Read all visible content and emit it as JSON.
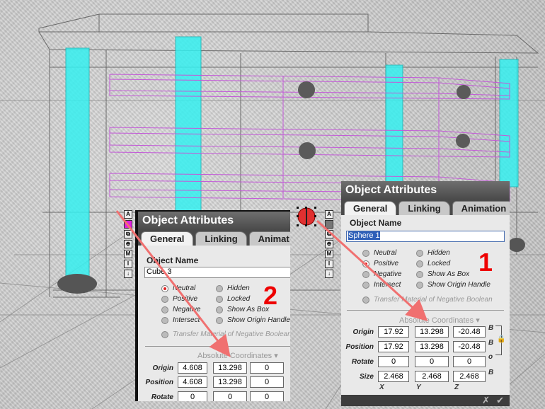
{
  "panel_right": {
    "title": "Object Attributes",
    "tabs": [
      "General",
      "Linking",
      "Animation"
    ],
    "object_name_label": "Object Name",
    "object_name_value": "Sphere 1",
    "options": {
      "neutral": "Neutral",
      "positive": "Positive",
      "negative": "Negative",
      "intersect": "Intersect",
      "hidden": "Hidden",
      "locked": "Locked",
      "show_as_box": "Show As Box",
      "show_origin_handle": "Show Origin Handle"
    },
    "selected_option": "Positive",
    "transfer": "Transfer Material of Negative Boolean",
    "abs_coords": "Absolute Coordinates",
    "rows": {
      "origin": {
        "label": "Origin",
        "x": "17.92",
        "y": "13.298",
        "z": "-20.48"
      },
      "position": {
        "label": "Position",
        "x": "17.92",
        "y": "13.298",
        "z": "-20.48"
      },
      "rotate": {
        "label": "Rotate",
        "x": "0",
        "y": "0",
        "z": "0"
      },
      "size": {
        "label": "Size",
        "x": "2.468",
        "y": "2.468",
        "z": "2.468"
      }
    },
    "axes": {
      "x": "X",
      "y": "Y",
      "z": "Z"
    },
    "side_b": "B",
    "side_deg": "o",
    "callout": "1",
    "footer_cancel": "✗",
    "footer_ok": "✔"
  },
  "panel_left": {
    "title": "Object Attributes",
    "tabs": [
      "General",
      "Linking",
      "Animat"
    ],
    "object_name_label": "Object Name",
    "object_name_value": "Cube 3",
    "options": {
      "neutral": "Neutral",
      "positive": "Positive",
      "negative": "Negative",
      "intersect": "Intersect",
      "hidden": "Hidden",
      "locked": "Locked",
      "show_as_box": "Show As Box",
      "show_origin_handle": "Show Origin Handle"
    },
    "selected_option": "Neutral",
    "transfer": "Transfer Material of Negative Boolean",
    "abs_coords": "Absolute Coordinates",
    "rows": {
      "origin": {
        "label": "Origin",
        "x": "4.608",
        "y": "13.298",
        "z": "0"
      },
      "position": {
        "label": "Position",
        "x": "4.608",
        "y": "13.298",
        "z": "0"
      },
      "rotate": {
        "label": "Rotate",
        "x": "0",
        "y": "0",
        "z": "0"
      }
    },
    "callout": "2"
  },
  "toolstrip": {
    "labels": [
      "A",
      "■",
      "⧉",
      "⊕",
      "M",
      "I",
      "↓"
    ]
  },
  "colors": {
    "cyan": "#36f0f0",
    "magenta": "#c35ad8",
    "arrow": "#f07070",
    "callout": "#e00000",
    "sphere": "#e03030"
  }
}
